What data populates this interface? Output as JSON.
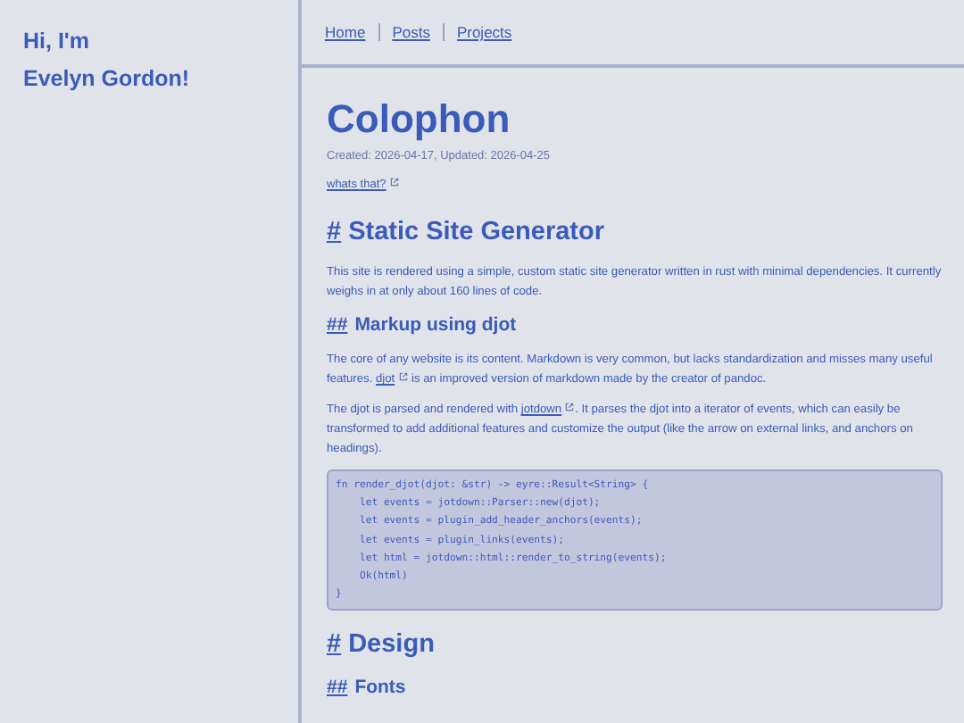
{
  "sidebar": {
    "greeting": [
      "Hi, I'm",
      "Evelyn Gordon!"
    ]
  },
  "nav": [
    {
      "label": "Home"
    },
    {
      "label": "Posts"
    },
    {
      "label": "Projects"
    }
  ],
  "page": {
    "title": "Colophon",
    "meta": "Created: 2026-04-17, Updated: 2026-04-25",
    "explain_link": "whats that?"
  },
  "blocks": [
    {
      "kind": "h1",
      "anchor": "#",
      "text": "Static Site Generator"
    },
    {
      "kind": "paragraph",
      "parts": [
        {
          "kind": "text",
          "text": "This site is rendered using a simple, custom static site generator written in rust with minimal dependencies. It currently weighs in at only about 160 lines of code."
        }
      ]
    },
    {
      "kind": "h2",
      "anchor": "##",
      "text": "Markup using djot"
    },
    {
      "kind": "paragraph",
      "parts": [
        {
          "kind": "text",
          "text": "The core of any website is its content. Markdown is very common, but lacks standardization and misses many useful features. "
        },
        {
          "kind": "link",
          "text": "djot"
        },
        {
          "kind": "text",
          "text": " is an improved version of markdown made by the creator of pandoc."
        }
      ]
    },
    {
      "kind": "paragraph",
      "parts": [
        {
          "kind": "text",
          "text": "The djot is parsed and rendered with "
        },
        {
          "kind": "link",
          "text": "jotdown"
        },
        {
          "kind": "text",
          "text": ". It parses the djot into a iterator of events, which can easily be transformed to add additional features and customize the output (like the arrow on external links, and anchors on headings)."
        }
      ]
    },
    {
      "kind": "code",
      "lines": [
        "fn render_djot(djot: &str) -> eyre::Result<String> {",
        "    let events = jotdown::Parser::new(djot);",
        "    let events = plugin_add_header_anchors(events);",
        "    let events = plugin_links(events);",
        "    let html = jotdown::html::render_to_string(events);",
        "    Ok(html)",
        "}"
      ]
    },
    {
      "kind": "h1",
      "anchor": "#",
      "text": "Design"
    },
    {
      "kind": "h2",
      "anchor": "##",
      "text": "Fonts"
    }
  ]
}
